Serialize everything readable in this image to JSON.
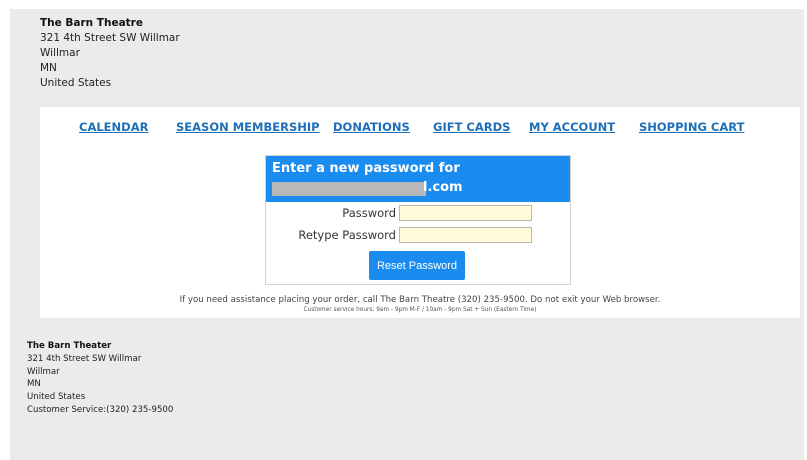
{
  "header": {
    "venue_name": "The Barn Theatre",
    "street": "321 4th Street SW Willmar",
    "city": "Willmar",
    "state": "MN",
    "country": "United States"
  },
  "nav": {
    "items": [
      {
        "label": "CALENDAR"
      },
      {
        "label": "SEASON MEMBERSHIP"
      },
      {
        "label": "DONATIONS"
      },
      {
        "label": "GIFT CARDS"
      },
      {
        "label": "MY ACCOUNT"
      },
      {
        "label": "SHOPPING CART"
      }
    ],
    "link_color": "#1e6fb8"
  },
  "reset_form": {
    "title": "Enter a new password for",
    "email_visible_suffix": "l.com",
    "password_label": "Password",
    "password_value": "",
    "retype_label": "Retype Password",
    "retype_value": "",
    "submit_label": "Reset Password",
    "accent_color": "#1a8cf0",
    "input_bg": "#fffbd8"
  },
  "assistance": {
    "message": "If you need assistance placing your order, call The Barn Theatre (320) 235-9500. Do not exit your Web browser.",
    "hours": "Customer service hours: 9am - 9pm M-F / 10am - 9pm Sat + Sun (Eastern Time)"
  },
  "footer": {
    "venue_name": "The Barn Theater",
    "street": "321 4th Street SW Willmar",
    "city": "Willmar",
    "state": "MN",
    "country": "United States",
    "customer_service": "Customer Service:(320) 235-9500"
  }
}
